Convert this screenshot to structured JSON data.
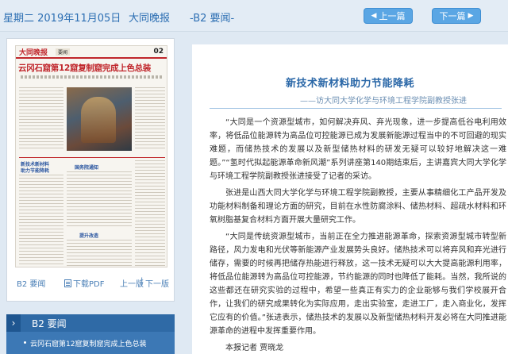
{
  "header": {
    "date": "星期二 2019年11月05日",
    "paper": "大同晚报",
    "page": "-B2 要闻-",
    "prev_label": "上一篇",
    "next_label": "下一篇"
  },
  "thumbnail": {
    "logo": "大同晚报",
    "section": "要闻",
    "page_no": "02",
    "headline": "云冈石窟第12窟复制窟完成上色总装",
    "box1": "新技术新材料",
    "box2": "助力节能降耗",
    "box3": "国务院通知",
    "box4": "提升改造",
    "footer": {
      "page": "B2 要闻",
      "pdf": "下载PDF",
      "prev": "上一版",
      "sep": "|",
      "next": "下一版"
    }
  },
  "index": {
    "chevron": "›",
    "title": "B2  要闻",
    "items": [
      "云冈石窟第12窟复制窟完成上色总装"
    ]
  },
  "article": {
    "title": "新技术新材料助力节能降耗",
    "subtitle": "——访大同大学化学与环境工程学院副教授张进",
    "paragraphs": [
      "“大同是一个资源型城市，如何解决弃风、弃光现象，进一步提高低谷电利用效率，将低品位能源转为高品位可控能源已成为发展新能源过程当中的不可回避的现实难题，而储热技术的发展以及新型储热材料的研发无疑可以较好地解决这一难题。”“氢时代拟起能源革命新风潮”系列讲座第140期结束后，主讲嘉宾大同大学化学与环境工程学院副教授张进接受了记者的采访。",
      "张进是山西大同大学化学与环境工程学院副教授，主要从事精细化工产品开发及功能材料制备和理论方面的研究，目前在水性防腐涂料、储热材料、超疏水材料和环氧树脂基复合材料方面开展大量研究工作。",
      "“大同是传统资源型城市，当前正在全力推进能源革命，探索资源型城市转型新路径，风力发电和光伏等新能源产业发展势头良好。储热技术可以将弃风和弃光进行储存，需要的时候再把储存热能进行释放，这一技术无疑可以大大提高能源利用率，将低品位能源转为高品位可控能源，节约能源的同时也降低了能耗。当然，我所说的这些都还在研究实验的过程中，希望一些真正有实力的企业能够与我们学校展开合作，让我们的研究成果转化为实际应用，走出实验室，走进工厂，走入商业化，发挥它应有的价值。”张进表示，储热技术的发展以及新型储热材料开发必将在大同推进能源革命的进程中发挥重要作用。"
    ],
    "author": "本报记者 贾晓龙"
  },
  "colors": {
    "accent": "#2b68a8",
    "button": "#5aa6e4",
    "index_bg": "#3c78b5",
    "headline_red": "#c0262b"
  }
}
